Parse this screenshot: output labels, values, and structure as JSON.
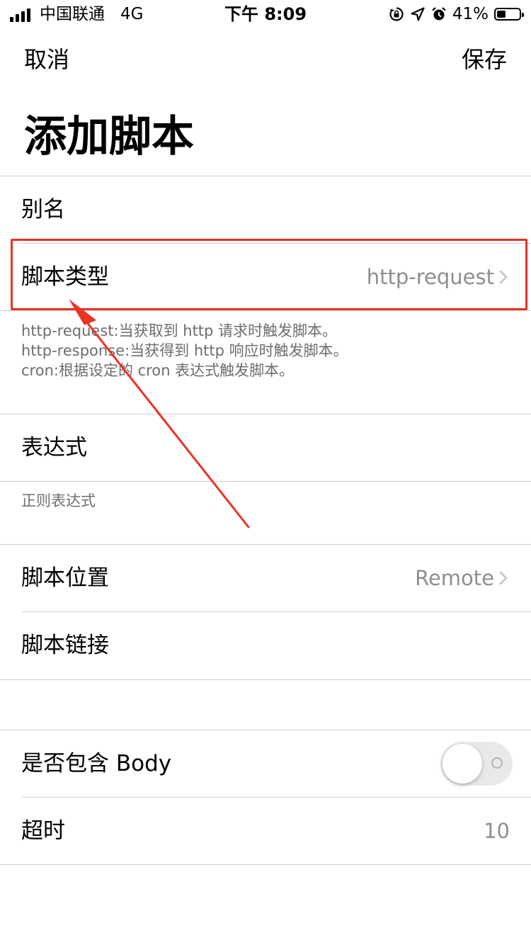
{
  "status_bar": {
    "carrier": "中国联通",
    "network": "4G",
    "time": "下午 8:09",
    "battery_percent": "41%",
    "battery_level": 0.41,
    "icons": [
      "signal-bars-icon",
      "rotation-lock-icon",
      "location-arrow-icon",
      "alarm-clock-icon",
      "battery-icon"
    ]
  },
  "nav": {
    "cancel": "取消",
    "save": "保存"
  },
  "title": "添加脚本",
  "form": {
    "alias_label": "别名",
    "script_type": {
      "label": "脚本类型",
      "value": "http-request"
    },
    "type_help": [
      "http-request:当获取到 http 请求时触发脚本。",
      "http-response:当获得到 http 响应时触发脚本。",
      "cron:根据设定的 cron 表达式触发脚本。"
    ],
    "expression_label": "表达式",
    "expression_help": "正则表达式",
    "script_location": {
      "label": "脚本位置",
      "value": "Remote"
    },
    "script_link_label": "脚本链接",
    "include_body": {
      "label": "是否包含 Body",
      "enabled": false
    },
    "timeout": {
      "label": "超时",
      "value": "10"
    }
  },
  "colors": {
    "annotation_red": "#ea3323",
    "secondary_text": "#8e8e93",
    "separator": "#d0d0d5",
    "toggle_off": "#e9e9ea"
  }
}
